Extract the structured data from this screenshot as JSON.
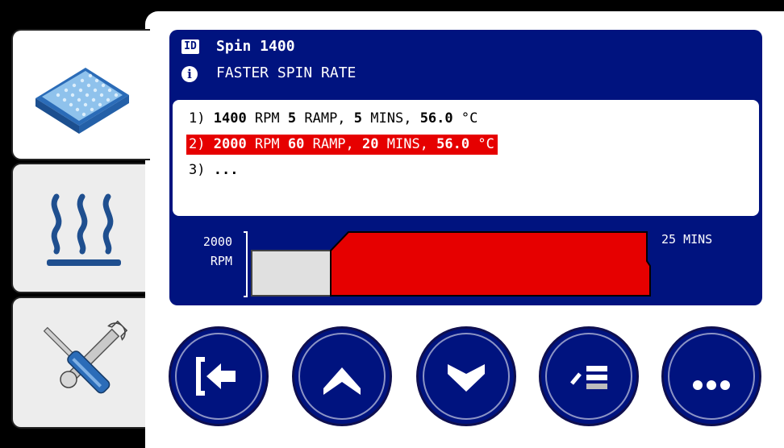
{
  "header": {
    "id_badge": "ID",
    "title": "Spin 1400",
    "info_badge": "i",
    "subtitle": "FASTER SPIN RATE"
  },
  "steps": [
    {
      "index": "1)",
      "rpm": "1400",
      "rpm_unit": " RPM ",
      "ramp": "5",
      "ramp_unit": " RAMP, ",
      "mins": "5",
      "mins_unit": " MINS, ",
      "temp": "56.0",
      "temp_unit": " °C",
      "selected": false
    },
    {
      "index": "2)",
      "rpm": "2000",
      "rpm_unit": " RPM ",
      "ramp": "60",
      "ramp_unit": " RAMP, ",
      "mins": "20",
      "mins_unit": " MINS, ",
      "temp": "56.0",
      "temp_unit": " °C",
      "selected": true
    },
    {
      "index": "3)",
      "more": "..."
    }
  ],
  "graph": {
    "speed_value": "2000",
    "speed_unit": "RPM",
    "time_label": "25 MINS",
    "fill_color": "#e60000",
    "prior_color": "#e0e0e0"
  },
  "sidebar": {
    "tabs": [
      {
        "name": "plate-tab",
        "icon": "well-plate-icon",
        "active": true
      },
      {
        "name": "heat-tab",
        "icon": "heat-icon",
        "active": false
      },
      {
        "name": "tools-tab",
        "icon": "tools-icon",
        "active": false
      }
    ]
  },
  "buttons": [
    {
      "name": "back",
      "icon": "exit-arrow-icon"
    },
    {
      "name": "up",
      "icon": "chevron-up-icon"
    },
    {
      "name": "down",
      "icon": "chevron-down-icon"
    },
    {
      "name": "edit",
      "icon": "edit-list-icon"
    },
    {
      "name": "more",
      "icon": "ellipsis-icon",
      "label": "..."
    }
  ],
  "colors": {
    "panel": "#00137f",
    "highlight": "#e60000",
    "accent_icon": "#2f6db5"
  }
}
